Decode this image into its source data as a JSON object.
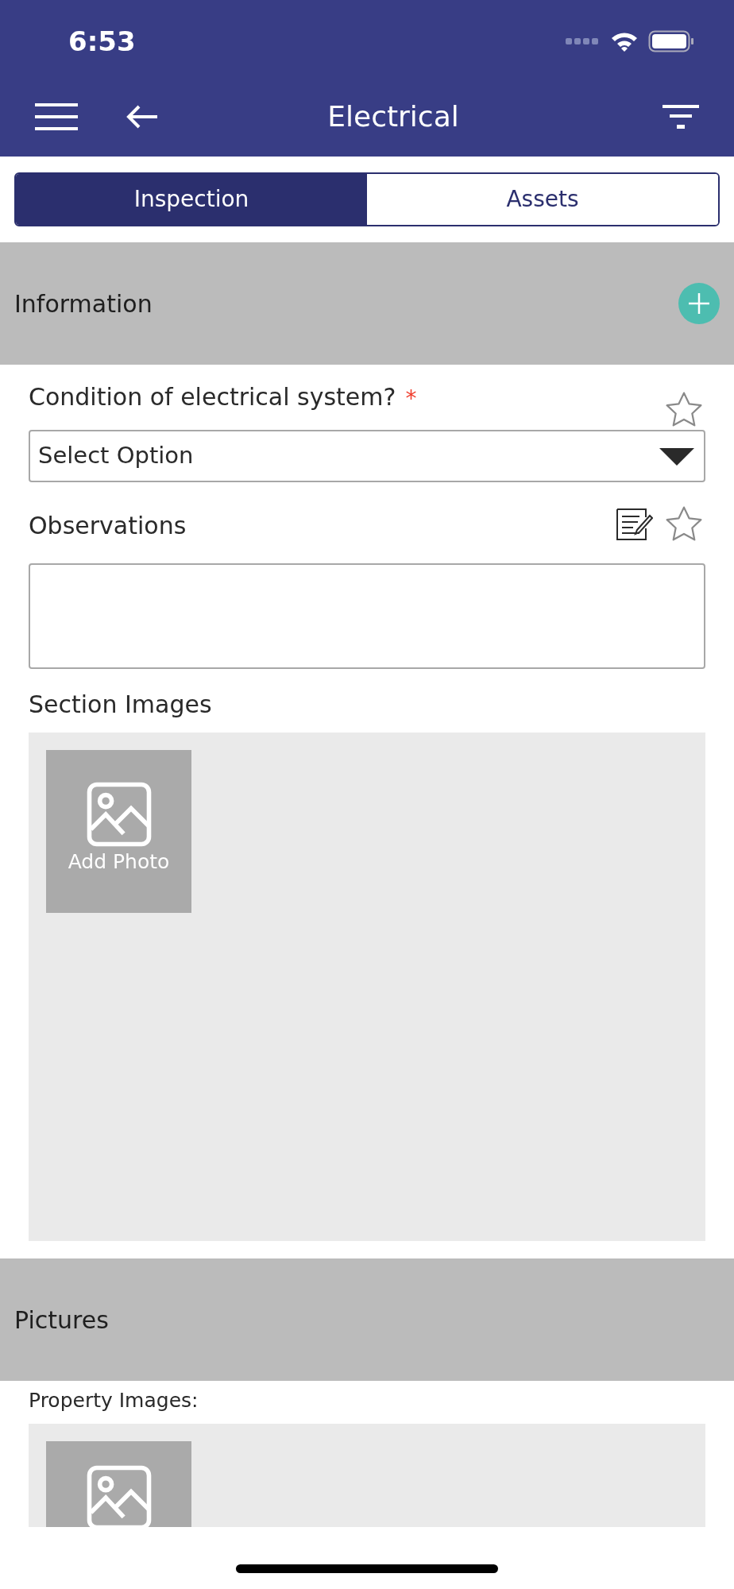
{
  "status_bar": {
    "time": "6:53"
  },
  "header": {
    "title": "Electrical"
  },
  "tabs": [
    {
      "label": "Inspection",
      "selected": true
    },
    {
      "label": "Assets",
      "selected": false
    }
  ],
  "sections": [
    {
      "title": "Information",
      "fields": [
        {
          "kind": "select",
          "label": "Condition of electrical system?",
          "required": true,
          "required_mark": "*",
          "placeholder": "Select Option"
        },
        {
          "kind": "textarea",
          "label": "Observations"
        },
        {
          "kind": "images",
          "label": "Section Images",
          "add_label": "Add Photo"
        }
      ]
    },
    {
      "title": "Pictures",
      "fields": [
        {
          "kind": "property_images",
          "label": "Property Images:"
        }
      ]
    }
  ]
}
